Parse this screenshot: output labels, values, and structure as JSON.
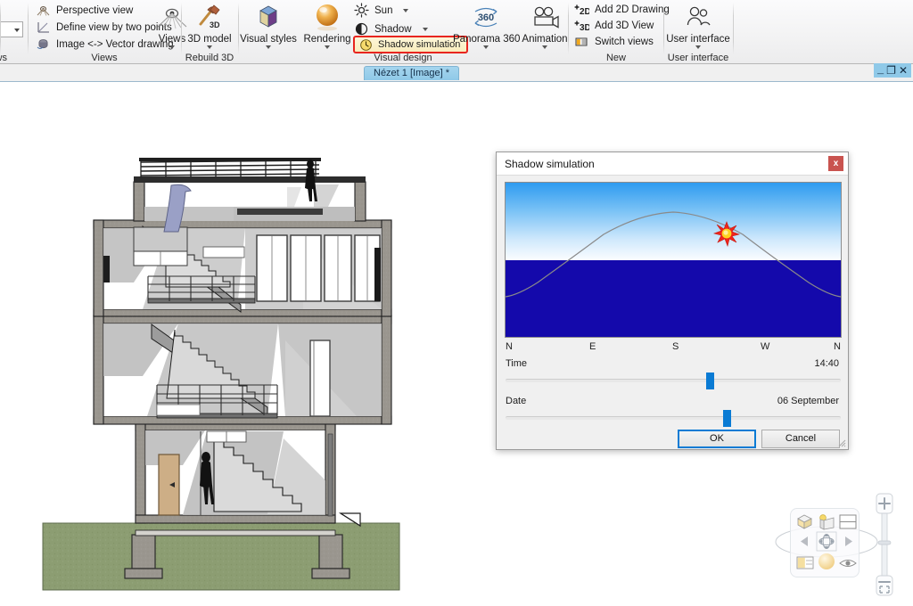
{
  "ribbon": {
    "left_stub": {
      "group_label": "iews"
    },
    "groups": [
      {
        "id": "views",
        "title": "Views",
        "items": [
          {
            "label": "Perspective view",
            "icon": "perspective-eye-icon"
          },
          {
            "label": "Define view by two points",
            "icon": "two-point-axis-icon"
          },
          {
            "label": "Image <-> Vector drawing",
            "icon": "image-vector-icon"
          }
        ],
        "big": {
          "label": "Views",
          "icon": "views-eye-icon",
          "has_dropdown": true
        }
      },
      {
        "id": "rebuild3d",
        "title": "Rebuild 3D",
        "big": {
          "label": "3D model",
          "icon": "hammer-3d-icon",
          "has_dropdown": true
        }
      },
      {
        "id": "visual-design",
        "title": "Visual design",
        "big_buttons": [
          {
            "label": "Visual styles",
            "icon": "cube-icon",
            "has_dropdown": true
          },
          {
            "label": "Rendering",
            "icon": "render-sphere-icon",
            "has_dropdown": true
          },
          {
            "label": "Panorama 360",
            "icon": "panorama-360-icon",
            "has_dropdown": true
          },
          {
            "label": "Animation",
            "icon": "camera-animation-icon",
            "has_dropdown": true
          }
        ],
        "items": [
          {
            "label": "Sun",
            "icon": "sun-icon",
            "has_dropdown": true
          },
          {
            "label": "Shadow",
            "icon": "shadow-halfmoon-icon",
            "has_dropdown": true
          },
          {
            "label": "Shadow simulation",
            "icon": "clock-icon",
            "highlighted": true
          }
        ],
        "highlight_color": "#e8251f"
      },
      {
        "id": "new",
        "title": "New",
        "items": [
          {
            "label": "Add 2D Drawing",
            "icon": "add-2d-icon"
          },
          {
            "label": "Add 3D View",
            "icon": "add-3d-icon"
          },
          {
            "label": "Switch views",
            "icon": "switch-views-icon"
          }
        ]
      },
      {
        "id": "user-interface",
        "title": "User interface",
        "big": {
          "label": "User interface",
          "icon": "users-icon",
          "has_dropdown": true
        }
      }
    ]
  },
  "tabbar": {
    "active_tab": "Nézet 1 [Image] *",
    "window_controls": {
      "minimize": "_",
      "restore": "❐",
      "close": "✕"
    }
  },
  "dialog": {
    "title": "Shadow simulation",
    "close_label": "x",
    "compass": [
      "N",
      "E",
      "S",
      "W",
      "N"
    ],
    "time": {
      "label": "Time",
      "value": "14:40",
      "thumb_percent": 61
    },
    "date": {
      "label": "Date",
      "value": "06 September",
      "thumb_percent": 66
    },
    "ok_label": "OK",
    "cancel_label": "Cancel",
    "sky": {
      "top_color": "#2e9bf0",
      "horizon_color": "#fbfdff",
      "ground_color": "#1409ab",
      "sun_position_percent": 63,
      "path_color": "#8a8a8a"
    }
  },
  "nav_widget": {
    "cells": [
      "cube-icon",
      "sunlight-box-icon",
      "split-view-icon",
      "rotate-left-icon",
      "orbit-icon",
      "rotate-right-icon",
      "section-icon",
      "sphere-icon",
      "eye-icon"
    ],
    "zoom_in": "+",
    "zoom_out": "−",
    "fit_label": "fit-to-screen-icon"
  }
}
